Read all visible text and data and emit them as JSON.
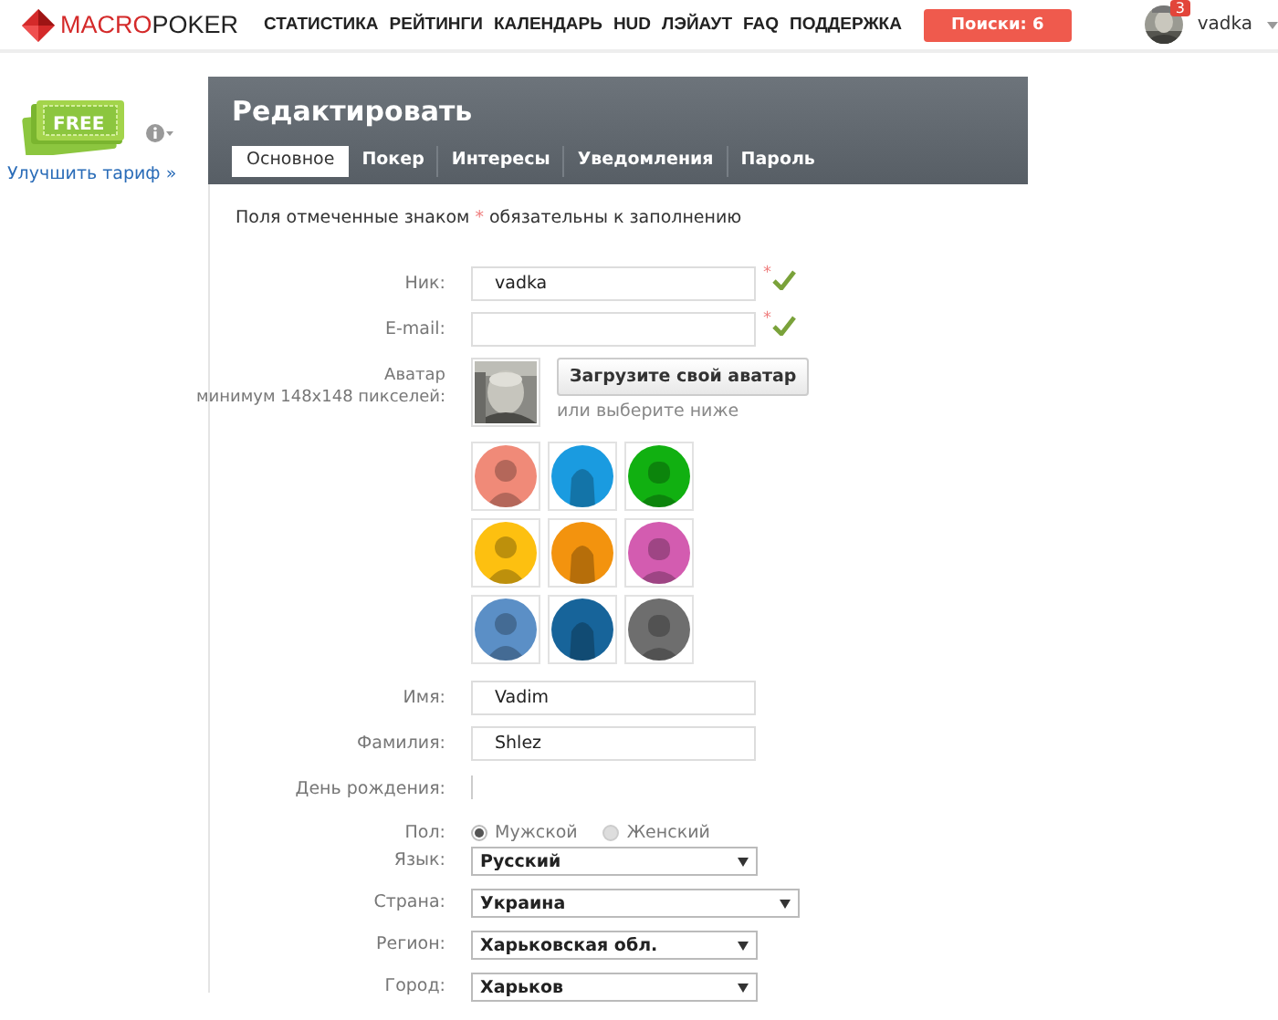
{
  "header": {
    "logo": {
      "first": "MACRO",
      "second": "POKER"
    },
    "nav": [
      "СТАТИСТИКА",
      "РЕЙТИНГИ",
      "КАЛЕНДАРЬ",
      "HUD",
      "ЛЭЙАУТ",
      "FAQ",
      "ПОДДЕРЖКА"
    ],
    "search_button": "Поиски: 6",
    "user": {
      "name": "vadka",
      "badge": "3"
    }
  },
  "sidebar": {
    "plan": "FREE",
    "upgrade_link": "Улучшить тариф »"
  },
  "panel": {
    "title": "Редактировать",
    "tabs": [
      {
        "label": "Основное",
        "selected": true
      },
      {
        "label": "Покер",
        "selected": false
      },
      {
        "label": "Интересы",
        "selected": false
      },
      {
        "label": "Уведомления",
        "selected": false
      },
      {
        "label": "Пароль",
        "selected": false
      }
    ],
    "note": {
      "before": "Поля отмеченные знаком",
      "mark": "*",
      "after": "обязательны к заполнению"
    },
    "fields": [
      {
        "kind": "text",
        "label": "Ник:",
        "value": "vadka",
        "required_mark": "*",
        "valid": true
      },
      {
        "kind": "text",
        "label": "E-mail:",
        "required_mark": "*",
        "valid": true
      },
      {
        "kind": "avatar",
        "label": "Аватар",
        "hint": "минимум 148x148 пикселей:",
        "upload_button": "Загрузите свой аватар",
        "choose_text": "или выберите ниже",
        "presets": [
          {
            "color": "#f08a78"
          },
          {
            "color": "#1a9be0"
          },
          {
            "color": "#11b011"
          },
          {
            "color": "#fdc010"
          },
          {
            "color": "#f3930e"
          },
          {
            "color": "#d35cb0"
          },
          {
            "color": "#5b8fc6"
          },
          {
            "color": "#17649a"
          },
          {
            "color": "#6e6e6e"
          }
        ]
      },
      {
        "kind": "text",
        "label": "Имя:",
        "value": "Vadim"
      },
      {
        "kind": "text",
        "label": "Фамилия:",
        "value": "Shlez"
      },
      {
        "kind": "date",
        "label": "День рождения:"
      },
      {
        "kind": "radio",
        "label": "Пол:",
        "options": [
          {
            "label": "Мужской",
            "selected": true
          },
          {
            "label": "Женский",
            "selected": false
          }
        ]
      },
      {
        "kind": "select",
        "label": "Язык:",
        "value": "Русский",
        "wide": false
      },
      {
        "kind": "select",
        "label": "Страна:",
        "value": "Украина",
        "wide": true
      },
      {
        "kind": "select",
        "label": "Регион:",
        "value": "Харьковская обл.",
        "wide": false
      },
      {
        "kind": "select",
        "label": "Город:",
        "value": "Харьков",
        "wide": false
      }
    ]
  }
}
